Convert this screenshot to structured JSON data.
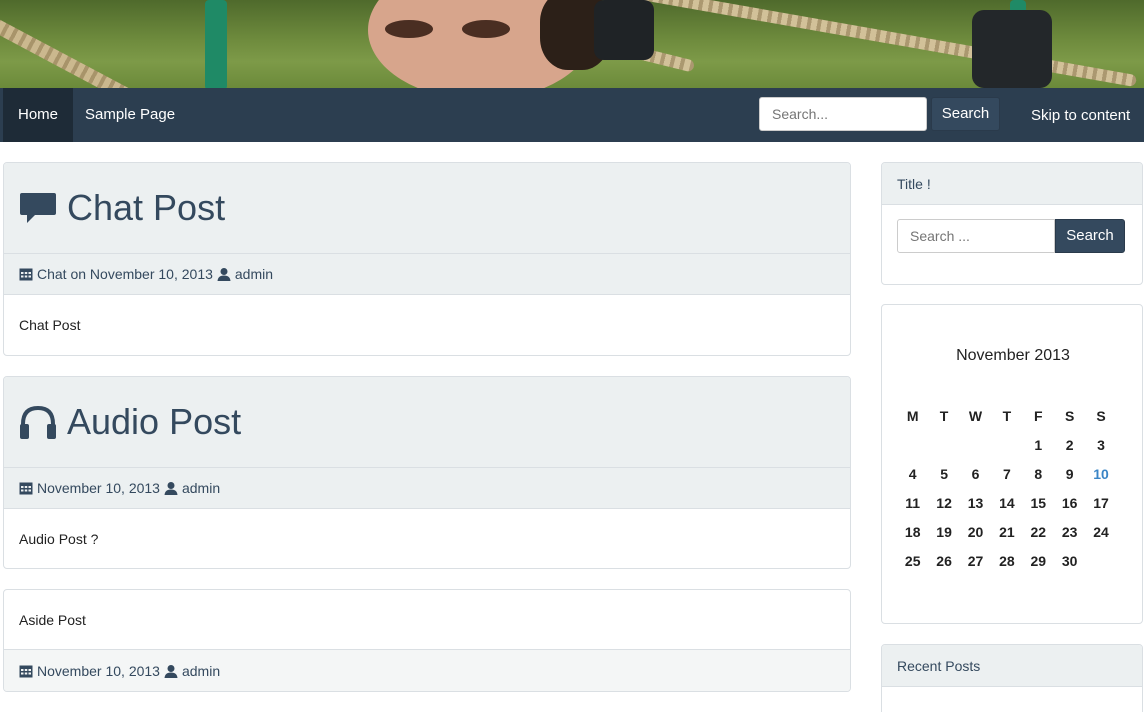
{
  "nav": {
    "items": [
      {
        "label": "Home"
      },
      {
        "label": "Sample Page"
      }
    ],
    "search_placeholder": "Search...",
    "search_button": "Search",
    "skip_link": "Skip to content"
  },
  "posts": [
    {
      "title": "Chat Post",
      "icon": "chat-bubble-icon",
      "meta_date": "Chat on November 10, 2013",
      "meta_author": "admin",
      "body": "Chat Post"
    },
    {
      "title": "Audio Post",
      "icon": "headphones-icon",
      "meta_date": "November 10, 2013",
      "meta_author": "admin",
      "body": "Audio Post ?"
    },
    {
      "title": "",
      "body": "Aside Post",
      "meta_date": "November 10, 2013",
      "meta_author": "admin"
    }
  ],
  "sidebar": {
    "search_widget": {
      "title": "Title !",
      "placeholder": "Search ...",
      "button": "Search"
    },
    "calendar": {
      "caption": "November 2013",
      "weekdays": [
        "M",
        "T",
        "W",
        "T",
        "F",
        "S",
        "S"
      ],
      "weeks": [
        [
          "",
          "",
          "",
          "",
          "1",
          "2",
          "3"
        ],
        [
          "4",
          "5",
          "6",
          "7",
          "8",
          "9",
          "10"
        ],
        [
          "11",
          "12",
          "13",
          "14",
          "15",
          "16",
          "17"
        ],
        [
          "18",
          "19",
          "20",
          "21",
          "22",
          "23",
          "24"
        ],
        [
          "25",
          "26",
          "27",
          "28",
          "29",
          "30",
          ""
        ]
      ],
      "today": "10"
    },
    "recent_posts": {
      "title": "Recent Posts"
    }
  },
  "colors": {
    "navbar": "#2c3e50",
    "accent": "#34495e",
    "panel_head": "#ecf0f1",
    "today": "#3a85c6"
  }
}
